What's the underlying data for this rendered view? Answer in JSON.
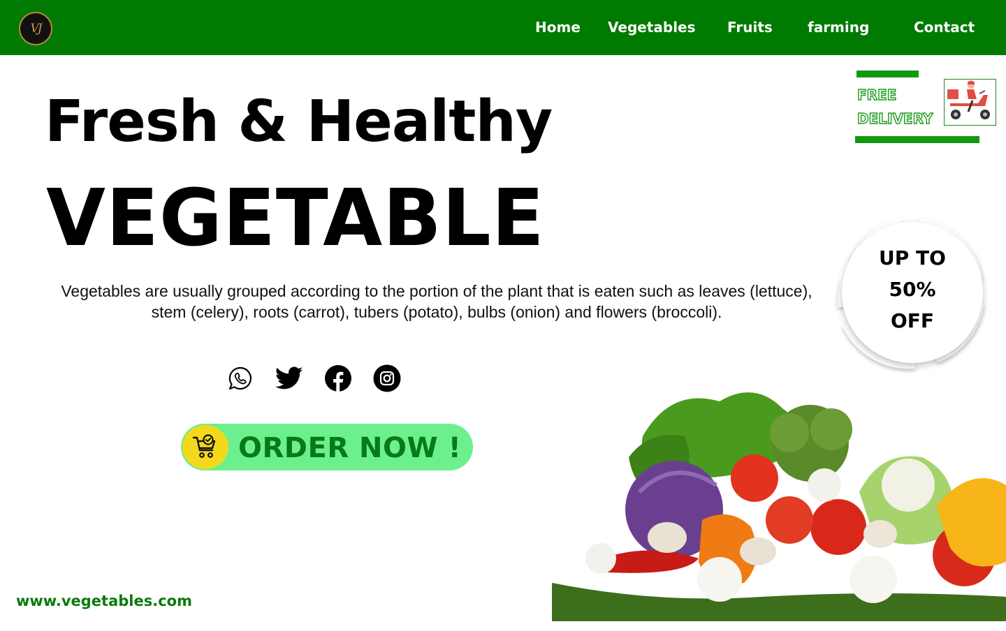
{
  "nav": {
    "logo_text": "VJ",
    "links": [
      "Home",
      "Vegetables",
      "Fruits",
      "farming",
      "Contact"
    ]
  },
  "hero": {
    "headline": "Fresh & Healthy",
    "headline_big": "VEGETABLE",
    "description": "Vegetables are usually grouped according to the portion of the plant that is eaten such as leaves (lettuce), stem (celery), roots (carrot), tubers (potato), bulbs (onion) and flowers (broccoli)."
  },
  "social": [
    "whatsapp-icon",
    "twitter-icon",
    "facebook-icon",
    "instagram-icon"
  ],
  "order": {
    "label": "ORDER NOW !",
    "icon": "shopping-cart-icon"
  },
  "delivery": {
    "line1": "FREE",
    "line2": "DELIVERY",
    "icon": "delivery-scooter-icon"
  },
  "badge": {
    "line1": "UP TO",
    "line2": "50%",
    "line3": "OFF"
  },
  "footer": {
    "url": "www.vegetables.com"
  },
  "colors": {
    "nav_green": "#017a01",
    "button_green": "#6cf08e",
    "button_text": "#067a16",
    "cart_yellow": "#f4d81c",
    "accent_green": "#0f9a0f"
  }
}
